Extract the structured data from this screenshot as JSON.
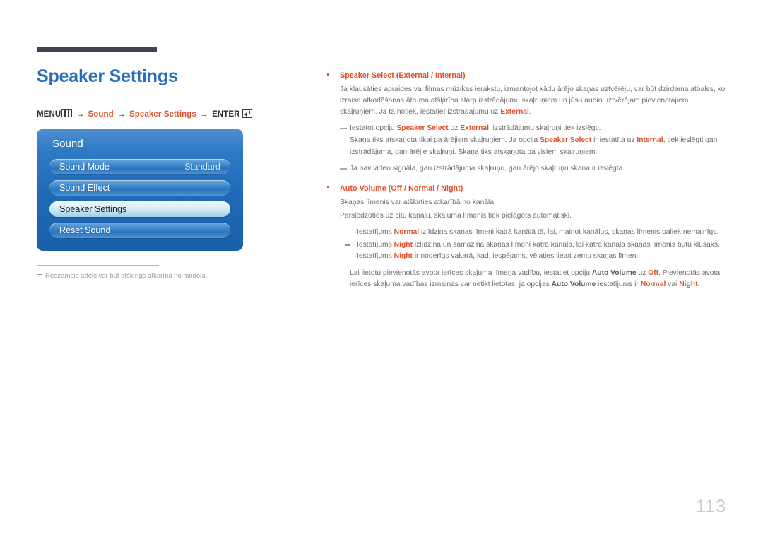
{
  "page": {
    "number": "113",
    "title": "Speaker Settings"
  },
  "menu_path": {
    "menu_label": "MENU",
    "arrow": "→",
    "step1": "Sound",
    "step2": "Speaker Settings",
    "enter_label": "ENTER",
    "menu_icon": "menu-bars-icon",
    "enter_icon": "enter-return-icon"
  },
  "osd": {
    "title": "Sound",
    "rows": [
      {
        "label": "Sound Mode",
        "value": "Standard",
        "selected": false
      },
      {
        "label": "Sound Effect",
        "value": "",
        "selected": false
      },
      {
        "label": "Speaker Settings",
        "value": "",
        "selected": true
      },
      {
        "label": "Reset Sound",
        "value": "",
        "selected": false
      }
    ]
  },
  "footnote": {
    "text": "Redzamais attēls var būt atšķirīgs atkarībā no modeļa."
  },
  "content": {
    "speaker_select": {
      "heading_bold": "Speaker Select",
      "heading_options": "(External / Internal)",
      "para1_a": "Ja klausāties apraides vai filmas mūzikas ierakstu, izmantojot kādu ārējo skaņas uztvērēju, var būt dzirdama atbalss, ko izraisa atkodēšanas ātruma atšķirība starp izstrādājumu skaļruņiem un jūsu audio uztvērējam pievienotajiem skaļruņiem. Ja tā notiek, iestatiet izstrādājumu uz ",
      "para1_b": "External",
      "para1_c": ".",
      "note1_l1_a": "Iestatot opciju ",
      "note1_l1_b": "Speaker Select",
      "note1_l1_c": " uz ",
      "note1_l1_d": "External",
      "note1_l1_e": ", izstrādājumu skaļruņi tiek izslēgti.",
      "note1_l2_a": "Skaņa tiks atskaņota tikai pa ārējiem skaļruņiem. Ja opcija ",
      "note1_l2_b": "Speaker Select",
      "note1_l2_c": " ir iestatīta uz ",
      "note1_l2_d": "Internal",
      "note1_l2_e": ", tiek ieslēgti gan",
      "note1_l3": "izstrādājuma, gan ārējie skaļruņi. Skaņa tiks atskaņota pa visiem skaļruņiem.",
      "note2": "Ja nav video signāla, gan izstrādājuma skaļruņu, gan ārējo skaļruņu skaņa ir izslēgta."
    },
    "auto_volume": {
      "heading_bold": "Auto Volume",
      "heading_options": "(Off / Normal / Night)",
      "para1": "Skaņas līmenis var atšķirties atkarībā no kanāla.",
      "para2": "Pārslēdzoties uz citu kanālu, skaļuma līmenis tiek pielāgots automātiski.",
      "sub1_a": "Iestatījums ",
      "sub1_b": "Normal",
      "sub1_c": " izlīdzina skaņas līmeni katrā kanālā tā, lai, mainot kanālus, skaņas līmenis paliek nemainīgs.",
      "sub2_a": "Iestatījums ",
      "sub2_b": "Night",
      "sub2_c": " izlīdzina un samazina skaņas līmeni katrā kanālā, lai katra kanāla skaņas līmenis būtu klusāks.",
      "sub2_d": "Iestatījums ",
      "sub2_e": "Night",
      "sub2_f": " ir noderīgs vakarā, kad, iespējams, vēlaties lietot zemu skaņas līmeni.",
      "note_l1_a": "Lai lietotu pievienotās avota ierīces skaļuma līmeņa vadību, iestatiet opciju ",
      "note_l1_b": "Auto Volume",
      "note_l1_c": " uz ",
      "note_l1_d": "Off",
      "note_l1_e": ". Pievienotās avota",
      "note_l2_a": "ierīces skaļuma vadības izmaiņas var netikt lietotas, ja opcijas ",
      "note_l2_b": "Auto Volume",
      "note_l2_c": " iestatījums ir ",
      "note_l2_d": "Normal",
      "note_l2_e": " vai ",
      "note_l2_f": "Night",
      "note_l2_g": "."
    }
  },
  "colors": {
    "accent_orange": "#e0502a",
    "title_blue": "#2a6fba",
    "body_grey": "#6d6d73",
    "rule_dark": "#454250"
  }
}
